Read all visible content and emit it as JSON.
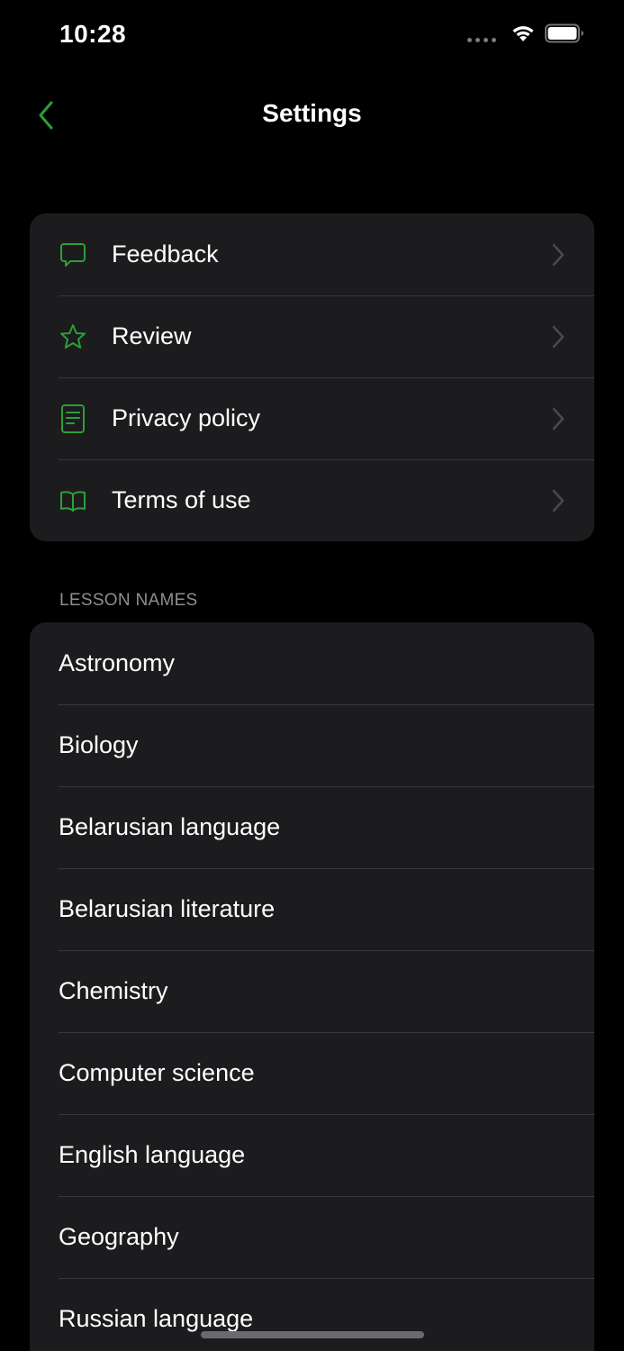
{
  "status_bar": {
    "time": "10:28"
  },
  "nav": {
    "title": "Settings",
    "back_icon": "chevron-left-icon"
  },
  "colors": {
    "accent": "#2e9e3a",
    "background": "#000000",
    "group_background": "#1c1c1e",
    "separator": "#38383a",
    "section_header": "#8e8e93"
  },
  "settings_group": {
    "items": [
      {
        "label": "Feedback",
        "icon": "speech-bubble-icon"
      },
      {
        "label": "Review",
        "icon": "star-icon"
      },
      {
        "label": "Privacy policy",
        "icon": "document-icon"
      },
      {
        "label": "Terms of use",
        "icon": "book-icon"
      }
    ]
  },
  "lessons": {
    "header": "LESSON NAMES",
    "items": [
      "Astronomy",
      "Biology",
      "Belarusian language",
      "Belarusian literature",
      "Chemistry",
      "Computer science",
      "English language",
      "Geography",
      "Russian language"
    ]
  }
}
